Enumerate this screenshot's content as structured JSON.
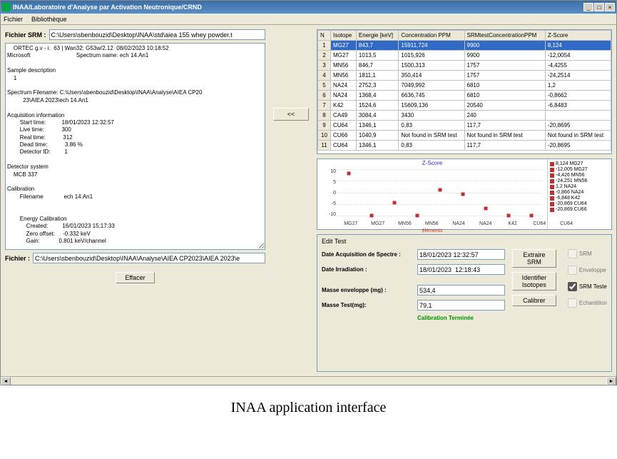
{
  "window": {
    "title": "INAA/Laboratoire d'Analyse par Activation Neutronique/CRND"
  },
  "menubar": {
    "file": "Fichier",
    "library": "Bibliothèque"
  },
  "left": {
    "srm_label": "Fichier SRM :",
    "srm_path": "C:\\Users\\sbenbouzid\\Desktop\\INAA\\std\\aiea 155 whey powder.t",
    "spectrum_text": "    ORTEC g.v - i.  63 | Wan32: G53w/2.12  08/02/2023 10:18:52\nMicrosoft                             Spectrum name: ech 14.An1\n\nSample description\n    1\n\nSpectrum Filename: C:\\Users\\sbenbouzid\\Desktop\\INAA\\Analyse\\AIEA CP20\n          23\\AIEA 2023\\ech 14.An1\n\nAcquisition information\n        Start time:          18/01/2023 12:32:57\n        Live time:           300\n        Real time:           312\n        Dead time:           3.86 %\n        Detector ID:         1\n\nDetector system\n    MCB 337\n\nCalibration\n        Filename             ech 14.An1\n\n\n        Energy Calibration\n            Created:         16/01/2023 15:17:33\n            Zero offset:     -0.332 keV\n            Gain:            0.801 keV/channel",
    "fichier_label": "Fichier :",
    "fichier_path": "C:\\Users\\sbenbouzid\\Desktop\\INAA\\Analyse\\AIEA CP2023\\AIEA 2023\\e",
    "effacer_btn": "Effacer"
  },
  "arrow_btn": "<<",
  "grid": {
    "cols": [
      "N",
      "Isotope",
      "Energie [keV]",
      "Concentration PPM",
      "SRMtestConcentrationPPM",
      "Z-Score"
    ],
    "rows": [
      {
        "n": "1",
        "iso": "MG27",
        "e": "843,7",
        "c": "15911,724",
        "s": "9900",
        "z": "8,124",
        "selected": true
      },
      {
        "n": "2",
        "iso": "MG27",
        "e": "1013,5",
        "c": "1015,926",
        "s": "9900",
        "z": "-12,0054"
      },
      {
        "n": "3",
        "iso": "MN56",
        "e": "846,7",
        "c": "1500,313",
        "s": "1757",
        "z": "-4,4255"
      },
      {
        "n": "4",
        "iso": "MN56",
        "e": "1811,1",
        "c": "350,414",
        "s": "1757",
        "z": "-24,2514"
      },
      {
        "n": "5",
        "iso": "NA24",
        "e": "2752,3",
        "c": "7049,992",
        "s": "6810",
        "z": "1,2"
      },
      {
        "n": "6",
        "iso": "NA24",
        "e": "1368,4",
        "c": "6636,745",
        "s": "6810",
        "z": "-0,8662"
      },
      {
        "n": "7",
        "iso": "K42",
        "e": "1524,6",
        "c": "15609,136",
        "s": "20540",
        "z": "-6,8483"
      },
      {
        "n": "8",
        "iso": "CA49",
        "e": "3084,4",
        "c": "3430",
        "s": "240",
        "z": ""
      },
      {
        "n": "9",
        "iso": "CU64",
        "e": "1346,1",
        "c": "0,83",
        "s": "117,7",
        "z": "-20,8695"
      },
      {
        "n": "10",
        "iso": "CU66",
        "e": "1040,9",
        "c": "Not found in SRM test",
        "s": "Not found in SRM test",
        "z": "Not found in SRM test"
      },
      {
        "n": "11",
        "iso": "CU64",
        "e": "1346,1",
        "c": "0,83",
        "s": "117,7",
        "z": "-20,8695"
      }
    ]
  },
  "chart_data": {
    "type": "scatter",
    "title": "Z-Score",
    "xlabel": "éléments",
    "ylabel": "",
    "ylim": [
      -10,
      10
    ],
    "yticks": [
      10,
      5,
      0,
      -5,
      -10
    ],
    "categories": [
      "MG27",
      "MG27",
      "MN56",
      "MN56",
      "NA24",
      "NA24",
      "K42",
      "CU64",
      "CU64"
    ],
    "values": [
      8.124,
      -12.005,
      -4.426,
      -24.251,
      1.2,
      -0.866,
      -6.848,
      -20.869,
      -20.869
    ],
    "legend": [
      "8,124 MG27",
      "-12,005 MG27",
      "-4,426 MN56",
      "-24,251 MN56",
      "1,2 NA24",
      "-0,866 NA24",
      "-6,848 K42",
      "-20,869 CU64",
      "-20,869 CU66"
    ]
  },
  "edit": {
    "title": "Edit Test",
    "date_acq_label": "Date Acquisition de Spectre :",
    "date_acq": "18/01/2023 12:32:57",
    "date_irr_label": "Date Irradiation :",
    "date_irr": "18/01/2023  12:18:43",
    "masse_env_label": "Masse enveloppe (mg) :",
    "masse_env": "534,4",
    "masse_test_label": "Masse Test(mg):",
    "masse_test": "79,1",
    "calib_done": "Calibration Terminée",
    "btn_extract": "Extraire SRM",
    "btn_identify": "Identifier Isotopes",
    "btn_calib": "Calibrer",
    "ck_srm": "SRM",
    "ck_env": "Enveloppe",
    "ck_srmtest": "SRM Teste",
    "ck_ech": "Echantillon"
  },
  "caption": "INAA application interface"
}
